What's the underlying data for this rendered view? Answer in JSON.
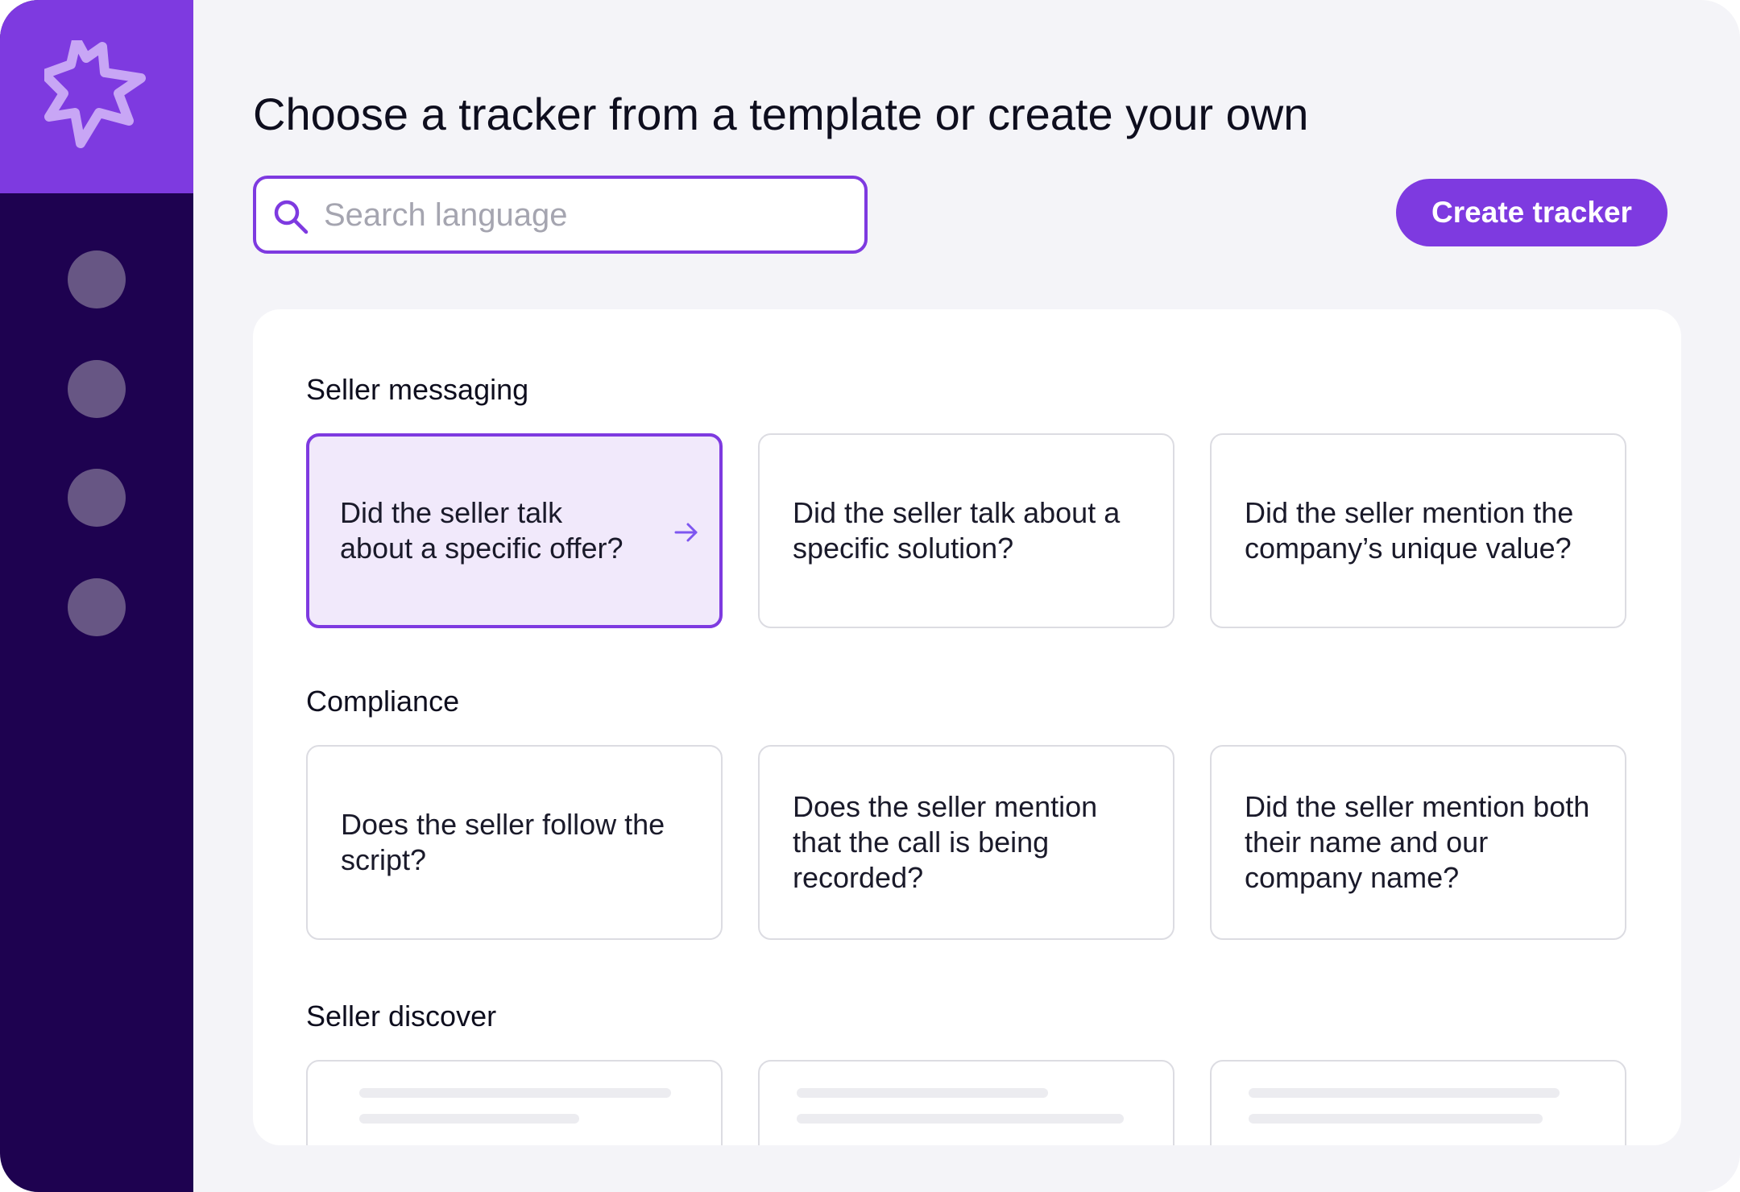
{
  "page": {
    "title": "Choose a tracker from a template or create your own"
  },
  "search": {
    "placeholder": "Search language"
  },
  "actions": {
    "create_label": "Create tracker"
  },
  "sections": [
    {
      "title": "Seller messaging",
      "cards": [
        {
          "text": "Did the seller talk about a specific offer?",
          "selected": true
        },
        {
          "text": "Did the seller talk about a specific solution?",
          "selected": false
        },
        {
          "text": "Did the seller mention the company’s unique value?",
          "selected": false
        }
      ]
    },
    {
      "title": "Compliance",
      "cards": [
        {
          "text": "Does the seller follow the script?",
          "selected": false
        },
        {
          "text": "Does the seller mention that the call is being recorded?",
          "selected": false
        },
        {
          "text": "Did the seller mention both their name and our company name?",
          "selected": false
        }
      ]
    },
    {
      "title": "Seller discover",
      "cards": []
    }
  ],
  "icons": {
    "logo": "starburst-logo-icon",
    "search": "search-icon",
    "arrow": "arrow-right-icon"
  },
  "colors": {
    "accent": "#7e3ae0",
    "sidebar": "#1e0250",
    "selected_card_bg": "#f1e9fb",
    "page_bg": "#f4f4f8"
  }
}
